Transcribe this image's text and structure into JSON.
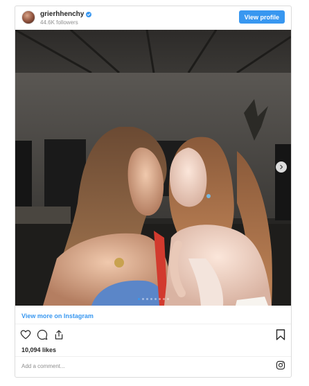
{
  "header": {
    "username": "grierhhenchy",
    "followers": "44.6K followers",
    "view_profile_label": "View profile"
  },
  "carousel": {
    "slides": 8,
    "active_index": 0
  },
  "footer": {
    "view_more_label": "View more on Instagram",
    "likes": "10,094 likes",
    "comment_placeholder": "Add a comment..."
  },
  "icons": {
    "verified": "verified-badge-icon",
    "next": "chevron-right-icon",
    "like": "heart-icon",
    "comment": "comment-icon",
    "share": "share-icon",
    "save": "bookmark-icon",
    "instagram": "instagram-logo-icon"
  },
  "colors": {
    "accent": "#3897f0",
    "text": "#262626",
    "muted": "#8e8e8e",
    "border": "#dbdbdb"
  }
}
